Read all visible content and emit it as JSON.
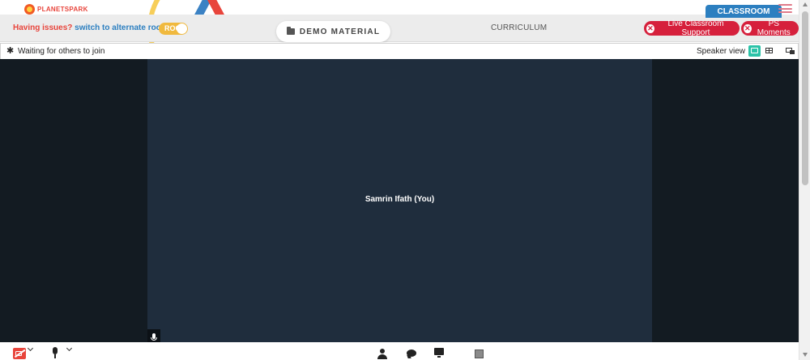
{
  "brand": {
    "name": "PLANETSPARK"
  },
  "header": {
    "issue_prefix": "Having issues?",
    "issue_link": "switch to alternate room",
    "toggle_label": "ROO",
    "demo_material": "DEMO MATERIAL",
    "curriculum": "CURRICULUM",
    "classroom_tag": "CLASSROOM",
    "live_support": "Live Classroom Support",
    "ps_moments": "PS Moments",
    "close_glyph": "✕"
  },
  "meeting_bar": {
    "status": "Waiting for others to join",
    "view_label": "Speaker view"
  },
  "stage": {
    "participant": "Samrin Ifath (You)"
  },
  "colors": {
    "accent_red": "#d6203c",
    "accent_blue": "#2c7fc0",
    "toggle_yellow": "#f0b93e",
    "tile_bg": "#1f2d3d",
    "stage_bg": "#131b22",
    "view_active": "#2bc3a8"
  },
  "icons": {
    "brand": "planetspark-logo-icon",
    "folder": "folder-icon",
    "menu": "hamburger-menu-icon",
    "close": "close-circle-icon",
    "settings": "gear-icon",
    "speaker_view": "speaker-view-icon",
    "gallery_view": "grid-view-icon",
    "pip": "picture-in-picture-icon",
    "tile_mic": "microphone-icon",
    "camera": "camera-off-icon",
    "mic": "microphone-icon",
    "participants": "person-icon",
    "chat": "chat-bubble-icon",
    "share": "screen-share-icon",
    "whiteboard": "whiteboard-icon"
  }
}
